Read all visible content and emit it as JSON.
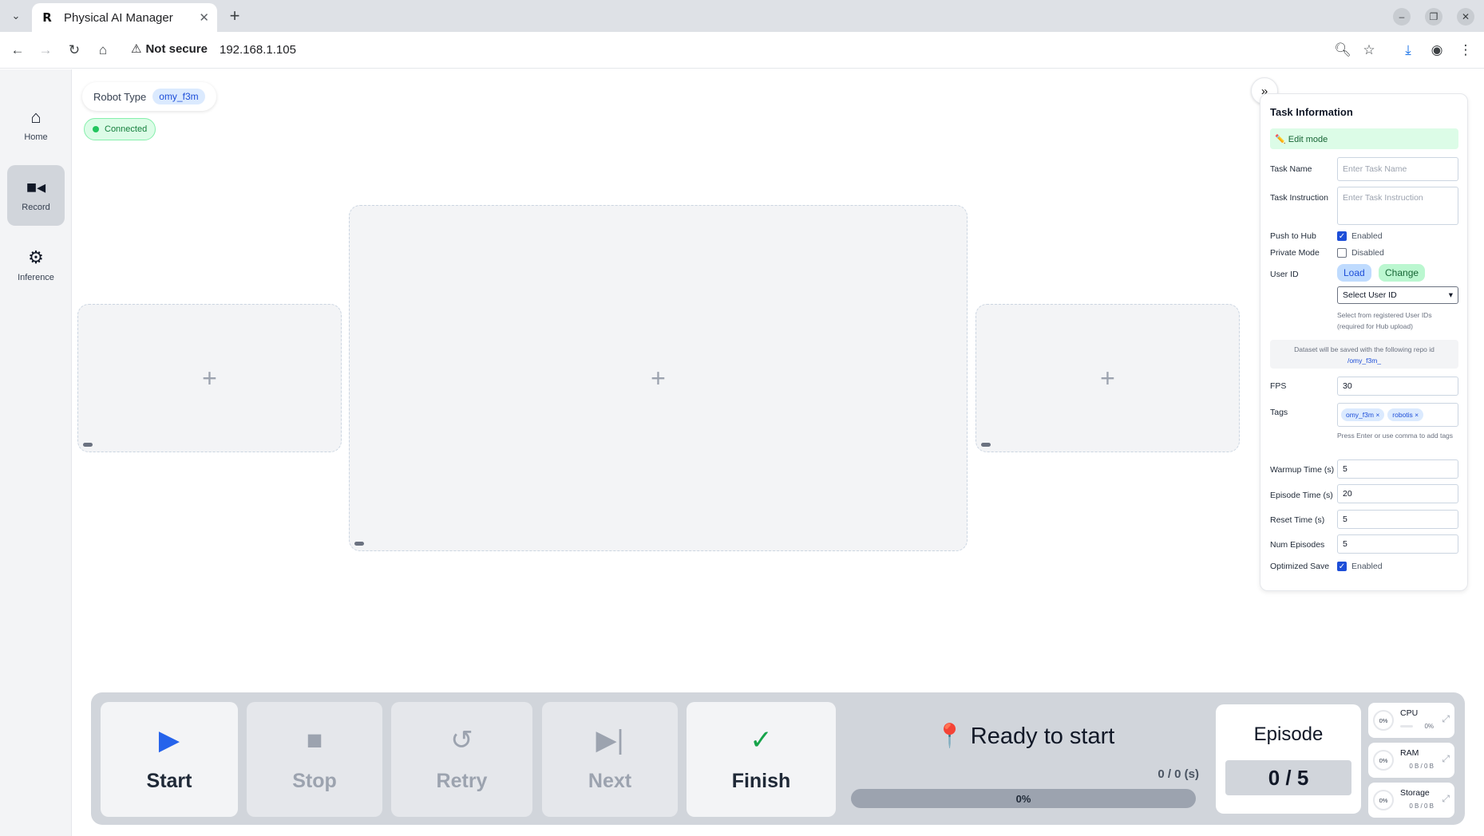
{
  "browser": {
    "tab_title": "Physical AI Manager",
    "tab_favicon": "R",
    "security_label": "Not secure",
    "url": "192.168.1.105"
  },
  "sidebar": {
    "items": [
      {
        "label": "Home",
        "icon": "home-icon",
        "active": false
      },
      {
        "label": "Record",
        "icon": "camera-icon",
        "active": true
      },
      {
        "label": "Inference",
        "icon": "chip-icon",
        "active": false
      }
    ]
  },
  "robot": {
    "type_label": "Robot Type",
    "type_value": "omy_f3m",
    "status": "Connected",
    "status_color": "#22c55e"
  },
  "task_panel": {
    "title": "Task Information",
    "edit_mode": "✏️ Edit mode",
    "task_name_label": "Task Name",
    "task_name_placeholder": "Enter Task Name",
    "task_instruction_label": "Task Instruction",
    "task_instruction_placeholder": "Enter Task Instruction",
    "push_to_hub_label": "Push to Hub",
    "push_to_hub_state": "Enabled",
    "private_mode_label": "Private Mode",
    "private_mode_state": "Disabled",
    "user_id_label": "User ID",
    "load_label": "Load",
    "change_label": "Change",
    "select_user_id": "Select User ID",
    "user_id_hint": "Select from registered User IDs (required for Hub upload)",
    "repo_note": "Dataset will be saved with the following repo id",
    "repo_id": "/omy_f3m_",
    "fps_label": "FPS",
    "fps_value": "30",
    "tags_label": "Tags",
    "tags": [
      "omy_f3m",
      "robotis"
    ],
    "tags_hint": "Press Enter or use comma to add tags",
    "warmup_label": "Warmup Time (s)",
    "warmup_value": "5",
    "episode_time_label": "Episode Time (s)",
    "episode_time_value": "20",
    "reset_time_label": "Reset Time (s)",
    "reset_time_value": "5",
    "num_episodes_label": "Num Episodes",
    "num_episodes_value": "5",
    "optimized_save_label": "Optimized Save",
    "optimized_save_state": "Enabled"
  },
  "controls": {
    "start": "Start",
    "stop": "Stop",
    "retry": "Retry",
    "next": "Next",
    "finish": "Finish",
    "start_color": "#2563eb",
    "finish_color": "#16a34a"
  },
  "status": {
    "message": "📍 Ready to start",
    "time": "0 / 0 (s)",
    "progress_text": "0%",
    "progress": 0
  },
  "episode": {
    "title": "Episode",
    "value": "0 / 5"
  },
  "resources": [
    {
      "name": "CPU",
      "percent": "0%",
      "value": "0%"
    },
    {
      "name": "RAM",
      "percent": "0%",
      "value": "0 B / 0 B"
    },
    {
      "name": "Storage",
      "percent": "0%",
      "value": "0 B / 0 B"
    }
  ]
}
